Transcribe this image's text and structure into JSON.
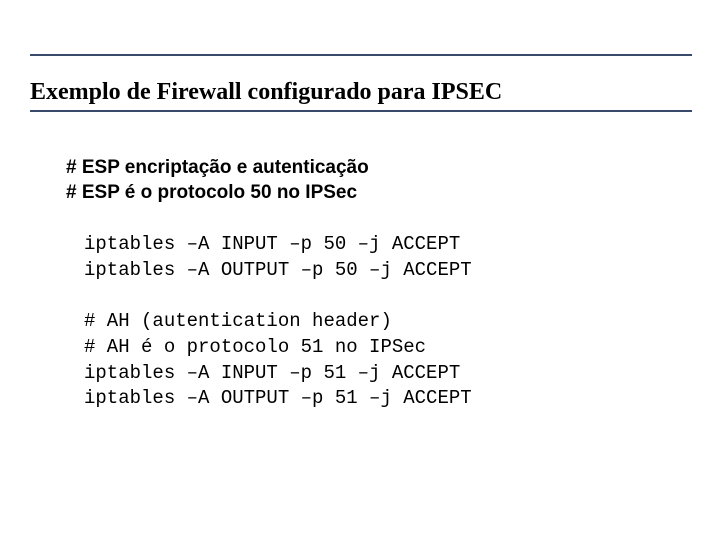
{
  "title": "Exemplo de Firewall configurado para IPSEC",
  "comments": {
    "l1": "# ESP encriptação e autenticação",
    "l2": "# ESP é o protocolo 50 no IPSec"
  },
  "code1": {
    "l1": "iptables –A INPUT –p 50 –j ACCEPT",
    "l2": "iptables –A OUTPUT –p 50 –j ACCEPT"
  },
  "code2": {
    "l1": "# AH (autentication header)",
    "l2": "# AH é o protocolo 51 no IPSec",
    "l3": "iptables –A INPUT –p 51 –j ACCEPT",
    "l4": "iptables –A OUTPUT –p 51 –j ACCEPT"
  }
}
